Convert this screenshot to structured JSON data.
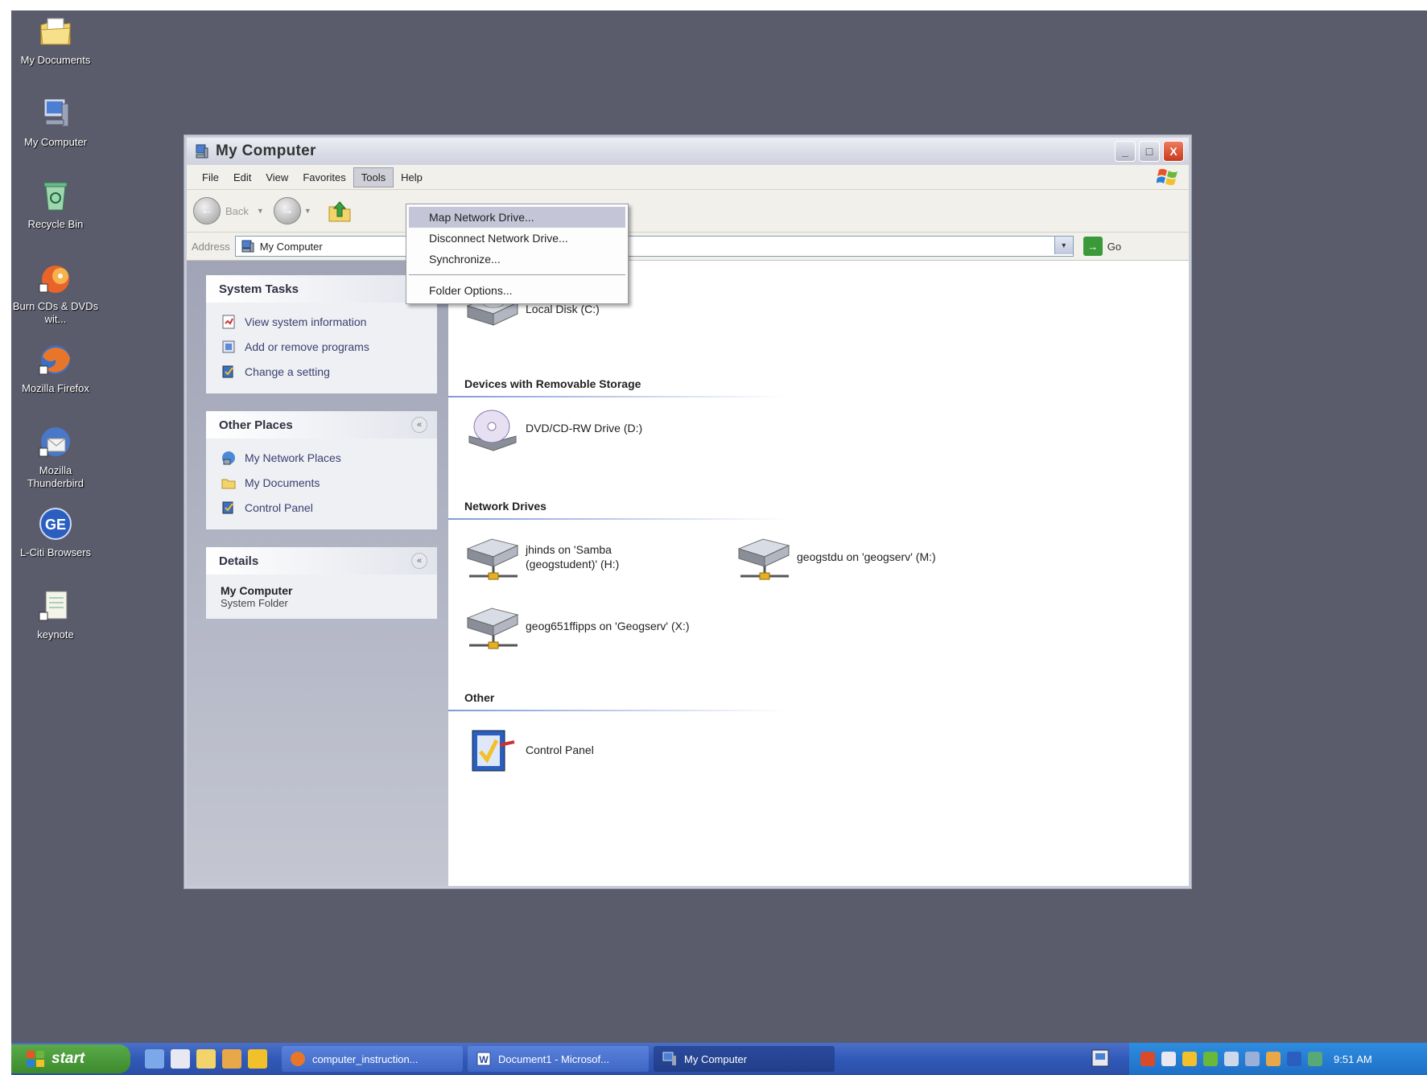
{
  "desktop": {
    "icons": [
      {
        "label": "My Documents",
        "icon": "my-documents-icon"
      },
      {
        "label": "My Computer",
        "icon": "my-computer-icon"
      },
      {
        "label": "Recycle Bin",
        "icon": "recycle-bin-icon"
      },
      {
        "label": "Burn CDs & DVDs wit...",
        "icon": "burn-cd-icon"
      },
      {
        "label": "Mozilla Firefox",
        "icon": "firefox-icon"
      },
      {
        "label": "Mozilla Thunderbird",
        "icon": "thunderbird-icon"
      },
      {
        "label": "L-Citi Browsers",
        "icon": "browsers-icon"
      },
      {
        "label": "keynote",
        "icon": "keynote-icon"
      }
    ]
  },
  "window": {
    "title": "My Computer",
    "controls": {
      "minimize": "_",
      "maximize": "□",
      "close": "X"
    }
  },
  "menubar": {
    "items": [
      "File",
      "Edit",
      "View",
      "Favorites",
      "Tools",
      "Help"
    ],
    "active": "Tools"
  },
  "toolbar": {
    "back_label": "Back",
    "back_arrow": "←",
    "forward_arrow": "→"
  },
  "address": {
    "label": "Address",
    "value": "My Computer",
    "dropdown": "▾",
    "go_label": "Go",
    "go_arrow": "→"
  },
  "tools_menu": {
    "items": [
      {
        "label": "Map Network Drive...",
        "highlighted": true
      },
      {
        "label": "Disconnect Network Drive...",
        "highlighted": false
      },
      {
        "label": "Synchronize...",
        "highlighted": false
      },
      {
        "label": "Folder Options...",
        "highlighted": false
      }
    ]
  },
  "sidebar": {
    "collapse_glyph": "«",
    "system_tasks": {
      "title": "System Tasks",
      "links": [
        "View system information",
        "Add or remove programs",
        "Change a setting"
      ]
    },
    "other_places": {
      "title": "Other Places",
      "links": [
        "My Network Places",
        "My Documents",
        "Control Panel"
      ]
    },
    "details": {
      "title": "Details",
      "name": "My Computer",
      "type": "System Folder"
    }
  },
  "main": {
    "hard_disk": {
      "label": "Local Disk (C:)"
    },
    "removable": {
      "heading": "Devices with Removable Storage",
      "label": "DVD/CD-RW Drive (D:)"
    },
    "network": {
      "heading": "Network Drives",
      "drives": [
        {
          "line1": "jhinds on 'Samba",
          "line2": "(geogstudent)' (H:)"
        },
        {
          "line1": "geogstdu on 'geogserv' (M:)",
          "line2": ""
        },
        {
          "line1": "geog651ffipps on 'Geogserv' (X:)",
          "line2": ""
        }
      ]
    },
    "other": {
      "heading": "Other",
      "label": "Control Panel"
    }
  },
  "taskbar": {
    "start_label": "start",
    "tasks": [
      {
        "label": "computer_instruction...",
        "active": false
      },
      {
        "label": "Document1 - Microsof...",
        "active": false
      },
      {
        "label": "My Computer",
        "active": true
      }
    ],
    "clock": "9:51 AM"
  },
  "colors": {
    "desktop": "#5a5b6b",
    "taskbar": "#3159b8",
    "start": "#3c8a2c",
    "menu_highlight": "#c4c6d8"
  }
}
